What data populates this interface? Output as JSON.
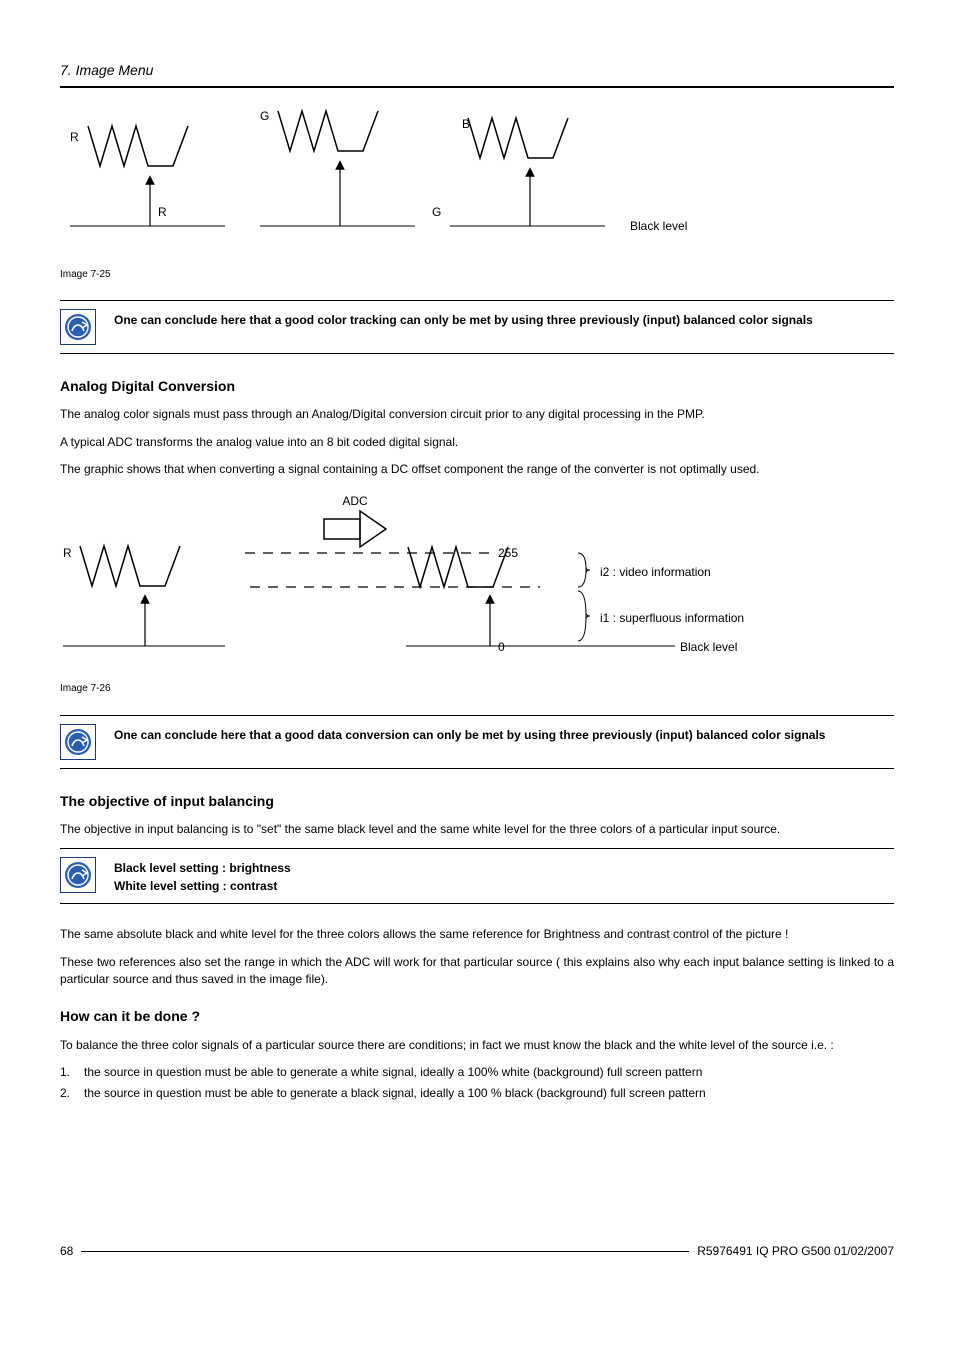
{
  "header": {
    "section": "7.  Image Menu"
  },
  "fig1": {
    "caption": "Image 7-25",
    "labelR": "R",
    "labelG": "G",
    "labelB": "B",
    "subR": "R",
    "subG": "G",
    "blacklevel": "Black level"
  },
  "callout1": {
    "text": "One can conclude here that a good color tracking can only be met by using three previously (input) balanced color signals"
  },
  "sec_adc": {
    "heading": "Analog Digital Conversion",
    "p1": "The analog color signals must pass through an Analog/Digital conversion circuit prior to any digital processing in the PMP.",
    "p2": "A typical ADC transforms the analog value into an 8 bit coded digital signal.",
    "p3": "The graphic shows that when converting a signal containing a DC offset component the range of the converter is not optimally used."
  },
  "fig2": {
    "caption": "Image 7-26",
    "labelR": "R",
    "labelADC": "ADC",
    "val255": "255",
    "val0": "0",
    "i2": "i2 : video information",
    "i1": "i1 : superfluous information",
    "blacklevel": "Black level"
  },
  "callout2": {
    "text": "One can conclude here that a good data conversion can only be met by using three previously (input) balanced color signals"
  },
  "sec_objective": {
    "heading": "The objective of input balancing",
    "p1": "The objective in input balancing is to \"set\" the same black level and the same white level for the three colors of a particular input source."
  },
  "callout3": {
    "line1": "Black level setting : brightness",
    "line2": "White level setting : contrast"
  },
  "post_callout3": {
    "p1": "The same absolute black and white level for the three colors allows the same reference for Brightness and contrast control of the picture !",
    "p2": "These two references also set the range in which the ADC will work for that particular source ( this explains also why each input balance setting is linked to a particular source and thus saved in the image file)."
  },
  "sec_how": {
    "heading": "How can it be done ?",
    "p1": "To balance the three color signals of a particular source there are conditions; in fact we must know the black and the white level of the source i.e.  :",
    "list": [
      {
        "n": "1.",
        "t": "the source in question must be able to generate a white signal, ideally a 100% white (background) full screen pattern"
      },
      {
        "n": "2.",
        "t": "the source in question must be able to generate a black signal, ideally a 100 % black (background) full screen pattern"
      }
    ]
  },
  "footer": {
    "page": "68",
    "ref": "R5976491  IQ PRO G500  01/02/2007"
  }
}
